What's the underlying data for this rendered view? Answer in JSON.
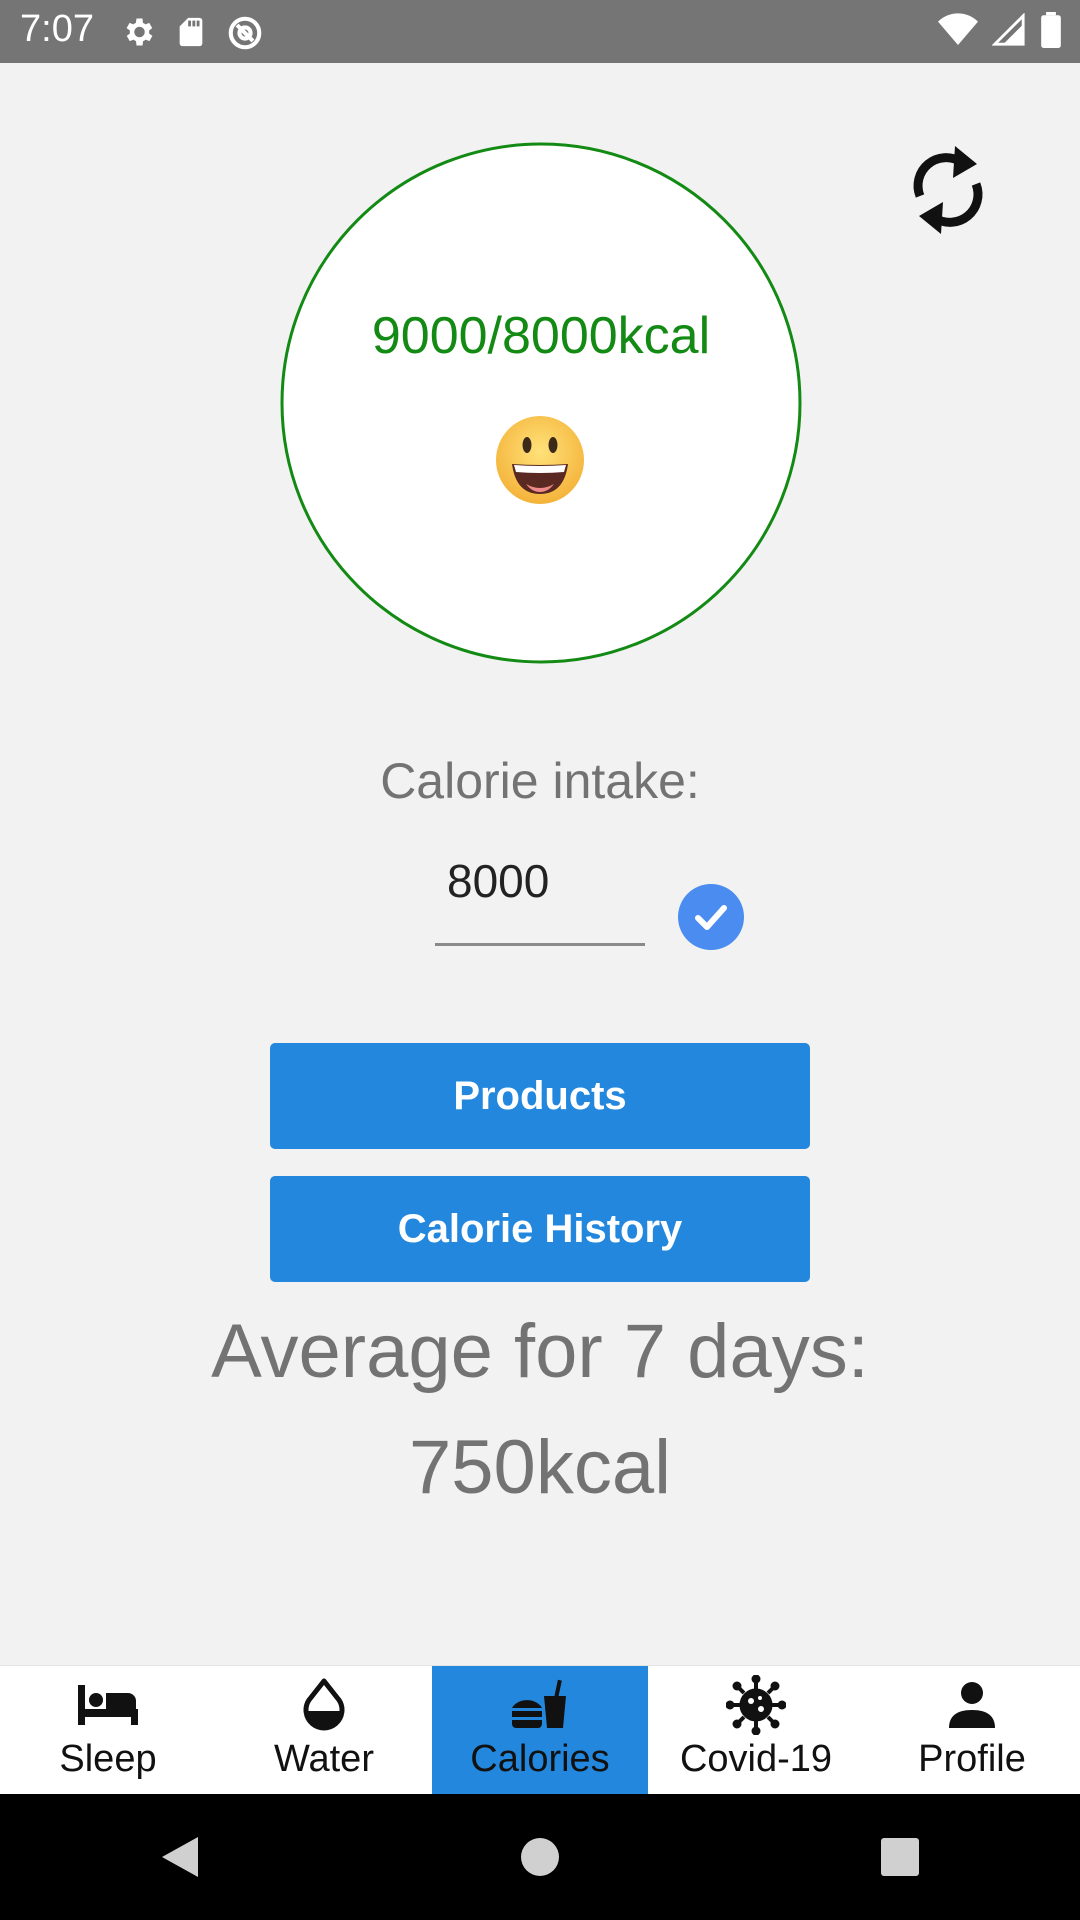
{
  "status_bar": {
    "time": "7:07",
    "icons": [
      "gear-icon",
      "sd-card-icon",
      "at-sign-icon",
      "wifi-icon",
      "signal-icon",
      "battery-icon"
    ]
  },
  "calorie_ring": {
    "text": "9000/8000kcal",
    "progress_fraction": 1.0,
    "ring_color": "#138a14",
    "emoji": "smiling-face"
  },
  "intake": {
    "label": "Calorie intake:",
    "value": "8000"
  },
  "buttons": {
    "products": "Products",
    "calorie_history": "Calorie History"
  },
  "average": {
    "label": "Average for 7 days:",
    "value": "750kcal"
  },
  "bottom_nav": {
    "items": [
      {
        "label": "Sleep",
        "icon": "bed-icon",
        "active": false
      },
      {
        "label": "Water",
        "icon": "water-drop-icon",
        "active": false
      },
      {
        "label": "Calories",
        "icon": "fastfood-icon",
        "active": true
      },
      {
        "label": "Covid-19",
        "icon": "virus-icon",
        "active": false
      },
      {
        "label": "Profile",
        "icon": "person-icon",
        "active": false
      }
    ]
  },
  "colors": {
    "accent": "#2388dd",
    "check": "#4a8cf0",
    "ring": "#138a14",
    "muted_text": "#737373"
  }
}
